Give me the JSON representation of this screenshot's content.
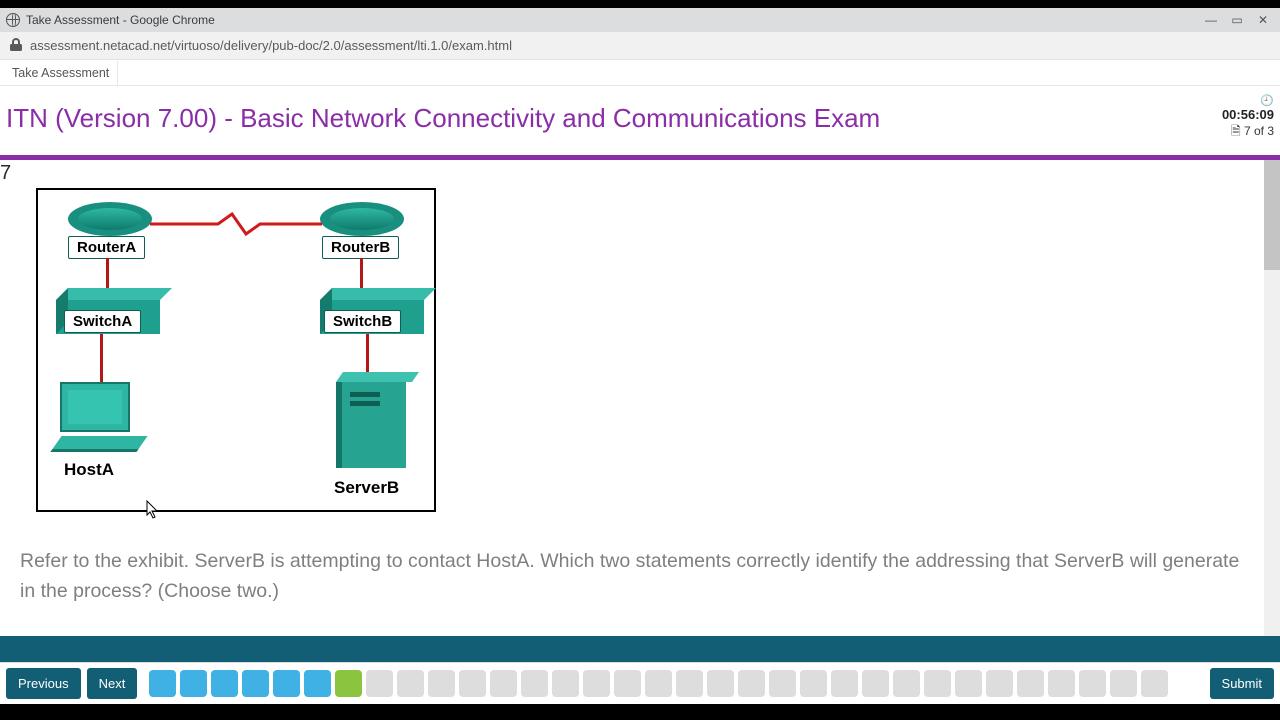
{
  "chrome": {
    "title": "Take Assessment - Google Chrome",
    "url": "assessment.netacad.net/virtuoso/delivery/pub-doc/2.0/assessment/lti.1.0/exam.html",
    "tab": "Take Assessment"
  },
  "exam": {
    "title": "ITN (Version 7.00) - Basic Network Connectivity and Communications Exam",
    "timer": "00:56:09",
    "progress": "7 of 3"
  },
  "question": {
    "number": "7",
    "text": "Refer to the exhibit. ServerB is attempting to contact HostA. Which two statements correctly identify the addressing that ServerB will generate in the process? (Choose two.)"
  },
  "exhibit": {
    "routerA": "RouterA",
    "routerB": "RouterB",
    "switchA": "SwitchA",
    "switchB": "SwitchB",
    "hostA": "HostA",
    "serverB": "ServerB"
  },
  "nav": {
    "previous": "Previous",
    "next": "Next",
    "submit": "Submit"
  },
  "questionBlocks": {
    "count": 33,
    "states": [
      "blue",
      "blue",
      "blue",
      "blue",
      "blue",
      "blue",
      "green",
      "grey",
      "grey",
      "grey",
      "grey",
      "grey",
      "grey",
      "grey",
      "grey",
      "grey",
      "grey",
      "grey",
      "grey",
      "grey",
      "grey",
      "grey",
      "grey",
      "grey",
      "grey",
      "grey",
      "grey",
      "grey",
      "grey",
      "grey",
      "grey",
      "grey",
      "grey"
    ]
  }
}
